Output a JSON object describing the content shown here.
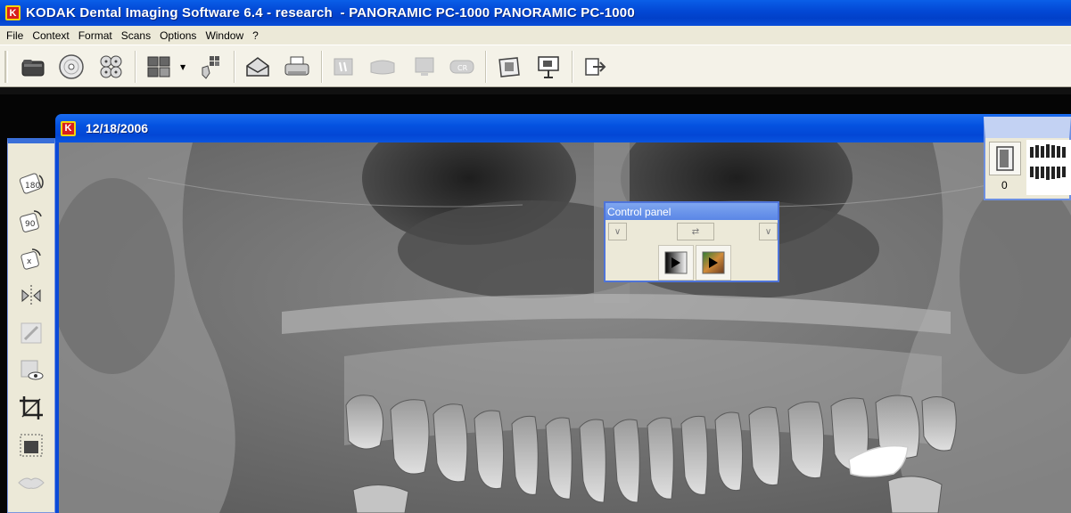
{
  "app": {
    "title": "KODAK Dental Imaging Software 6.4 - research  - PANORAMIC PC-1000 PANORAMIC PC-1000",
    "logo_letter": "K"
  },
  "menu": [
    "File",
    "Context",
    "Format",
    "Scans",
    "Options",
    "Window",
    "?"
  ],
  "toolbar": {
    "buttons": [
      "folder-icon",
      "cd-icon",
      "multi-cd-icon",
      "layout-icon",
      "acquire-icon",
      "envelope-icon",
      "printer-icon",
      "tooth-chart-icon",
      "intraoral-icon",
      "monitor-icon",
      "cr-icon",
      "frame-icon",
      "presentation-icon",
      "exit-icon"
    ]
  },
  "image_window": {
    "title": "12/18/2006",
    "logo_letter": "K"
  },
  "left_palette": {
    "tools": [
      "rotate-180-icon",
      "rotate-90-icon",
      "rotate-free-icon",
      "flip-icon",
      "pen-icon",
      "hide-eye-icon",
      "crop-icon",
      "select-region-icon",
      "lips-icon"
    ]
  },
  "control_panel": {
    "title": "Control panel"
  },
  "thumb_panel": {
    "count": "0"
  }
}
